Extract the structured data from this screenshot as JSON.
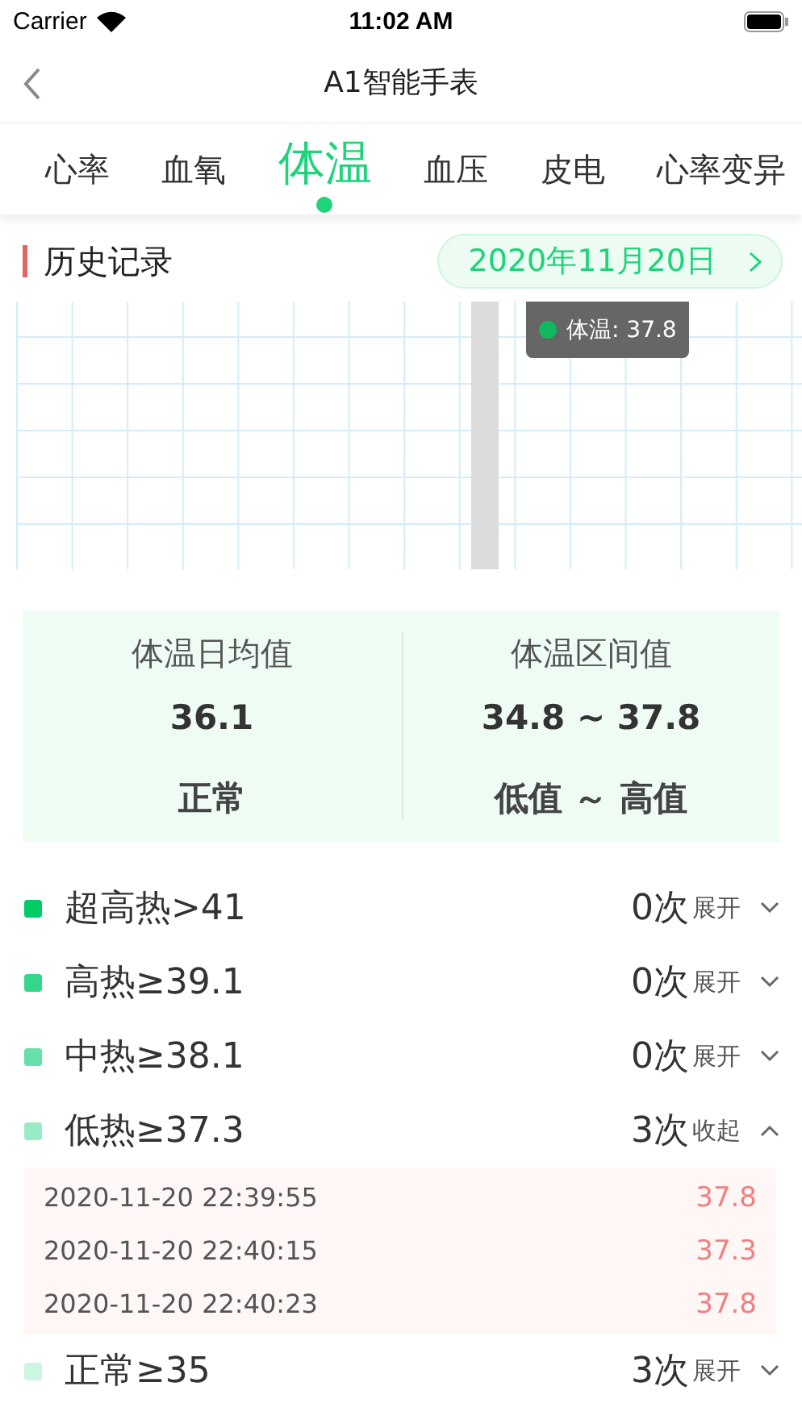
{
  "status_bar": {
    "carrier": "Carrier",
    "time": "11:02 AM"
  },
  "nav": {
    "title": "A1智能手表"
  },
  "tabs": [
    {
      "label": "心率",
      "selected": false
    },
    {
      "label": "血氧",
      "selected": false
    },
    {
      "label": "体温",
      "selected": true
    },
    {
      "label": "血压",
      "selected": false
    },
    {
      "label": "皮电",
      "selected": false
    },
    {
      "label": "心率变异",
      "selected": false
    }
  ],
  "history": {
    "title": "历史记录",
    "date": "2020年11月20日",
    "tooltip": "体温: 37.8"
  },
  "summary": [
    {
      "title": "体温日均值",
      "value": "36.1",
      "status": "正常"
    },
    {
      "title": "体温区间值",
      "value": "34.8 ~ 37.8",
      "status": "低值 ～ 高值"
    }
  ],
  "levels": [
    {
      "label": "超高热>41",
      "count": "0次",
      "action": "展开",
      "expanded": false,
      "color": "#00cc66"
    },
    {
      "label": "高热≥39.1",
      "count": "0次",
      "action": "展开",
      "expanded": false,
      "color": "#33d68a"
    },
    {
      "label": "中热≥38.1",
      "count": "0次",
      "action": "展开",
      "expanded": false,
      "color": "#66e0a8"
    },
    {
      "label": "低热≥37.3",
      "count": "3次",
      "action": "收起",
      "expanded": true,
      "color": "#99ebc5",
      "records": [
        {
          "time": "2020-11-20 22:39:55",
          "value": "37.8"
        },
        {
          "time": "2020-11-20 22:40:15",
          "value": "37.3"
        },
        {
          "time": "2020-11-20 22:40:23",
          "value": "37.8"
        }
      ]
    },
    {
      "label": "正常≥35",
      "count": "3次",
      "action": "展开",
      "expanded": false,
      "color": "#ccf5e2"
    }
  ]
}
